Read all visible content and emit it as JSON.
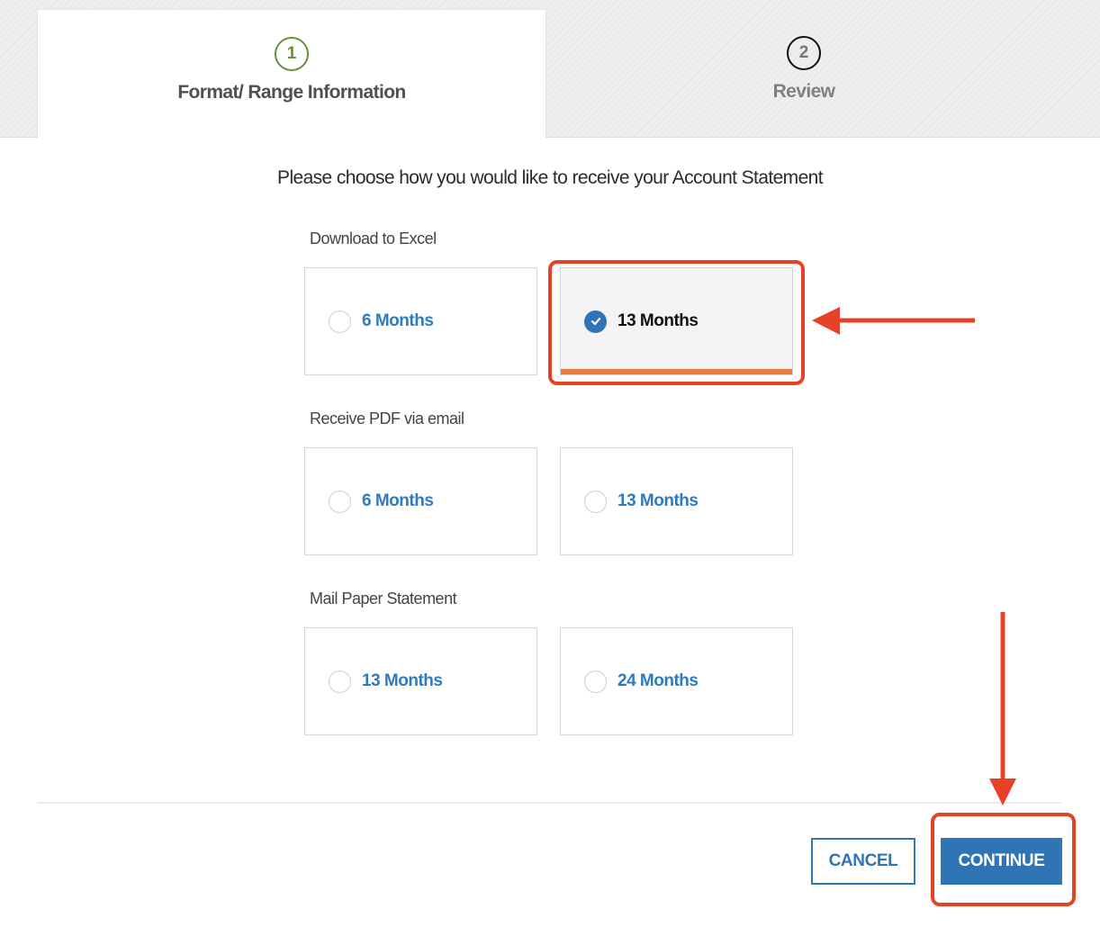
{
  "steps": [
    {
      "number": "1",
      "label": "Format/ Range Information",
      "state": "active"
    },
    {
      "number": "2",
      "label": "Review",
      "state": "inactive"
    }
  ],
  "prompt": "Please choose how you would like to receive your Account Statement",
  "sections": [
    {
      "label": "Download to Excel",
      "options": [
        {
          "label": "6 Months",
          "selected": false
        },
        {
          "label": "13 Months",
          "selected": true
        }
      ]
    },
    {
      "label": "Receive PDF via email",
      "options": [
        {
          "label": "6 Months",
          "selected": false
        },
        {
          "label": "13 Months",
          "selected": false
        }
      ]
    },
    {
      "label": "Mail Paper Statement",
      "options": [
        {
          "label": "13 Months",
          "selected": false
        },
        {
          "label": "24 Months",
          "selected": false
        }
      ]
    }
  ],
  "buttons": {
    "cancel": "CANCEL",
    "continue": "CONTINUE"
  },
  "colors": {
    "accent_blue": "#2f74b5",
    "step_active_green": "#6a8f3a",
    "selected_underline": "#e87a3c",
    "annotation_red": "#e8412a"
  },
  "icons": {
    "selected_radio": "check-circle-icon",
    "unselected_radio": "empty-circle-icon"
  }
}
